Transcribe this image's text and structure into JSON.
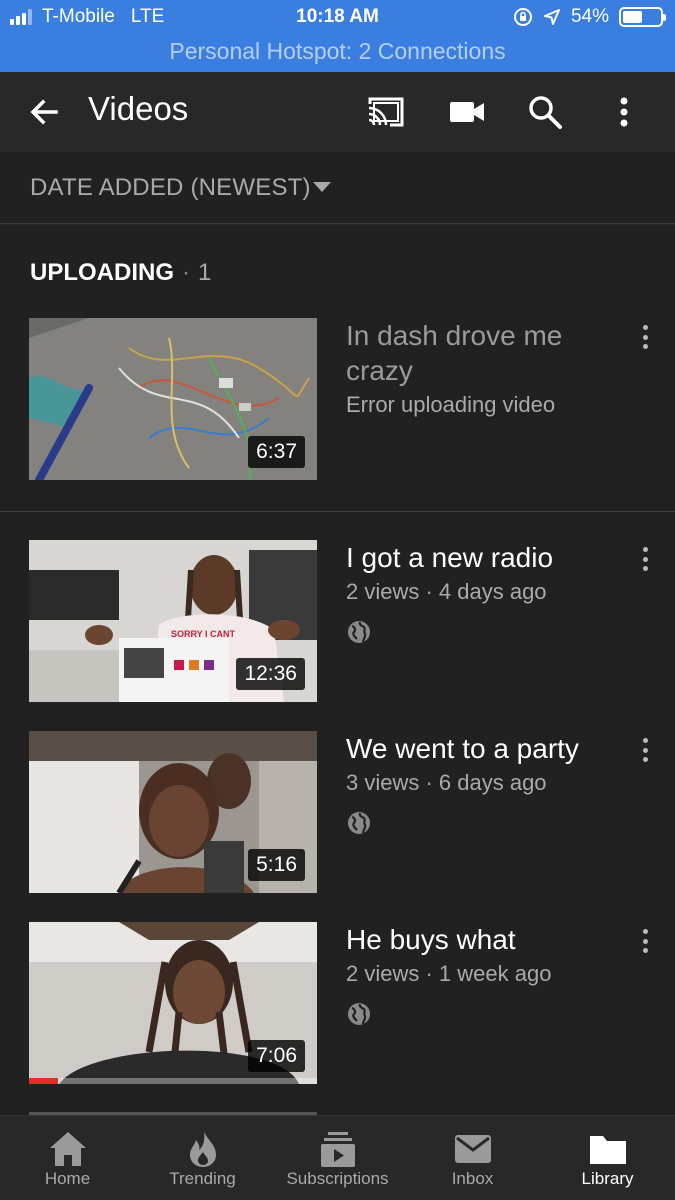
{
  "status_bar": {
    "carrier": "T-Mobile",
    "network": "LTE",
    "time": "10:18 AM",
    "battery": "54%",
    "battery_level": 0.54,
    "hotspot": "Personal Hotspot: 2 Connections"
  },
  "app_bar": {
    "title": "Videos",
    "icons": [
      "back-arrow-icon",
      "cast-icon",
      "video-camera-icon",
      "search-icon",
      "more-vert-icon"
    ]
  },
  "sort": {
    "label": "DATE ADDED (NEWEST)"
  },
  "uploading": {
    "heading": "UPLOADING",
    "count": "1",
    "item": {
      "title": "In dash drove me crazy",
      "status": "Error uploading video",
      "duration": "6:37"
    }
  },
  "videos": [
    {
      "title": "I got a new radio",
      "stats": "2 views · 4 days ago",
      "duration": "12:36",
      "visibility_icon": "globe-icon"
    },
    {
      "title": "We went to a party",
      "stats": "3 views · 6 days ago",
      "duration": "5:16",
      "visibility_icon": "globe-icon"
    },
    {
      "title": "He buys what",
      "stats": "2 views · 1 week ago",
      "duration": "7:06",
      "visibility_icon": "globe-icon",
      "watched_fraction": 0.1
    }
  ],
  "bottom_nav": [
    {
      "label": "Home",
      "icon": "home-icon"
    },
    {
      "label": "Trending",
      "icon": "flame-icon"
    },
    {
      "label": "Subscriptions",
      "icon": "subscriptions-icon"
    },
    {
      "label": "Inbox",
      "icon": "inbox-icon"
    },
    {
      "label": "Library",
      "icon": "folder-icon",
      "active": true
    }
  ],
  "colors": {
    "status_bar": "#3a7fe0",
    "app_bar": "#282828",
    "content_bg": "#212121",
    "progress": "#e52d27"
  }
}
